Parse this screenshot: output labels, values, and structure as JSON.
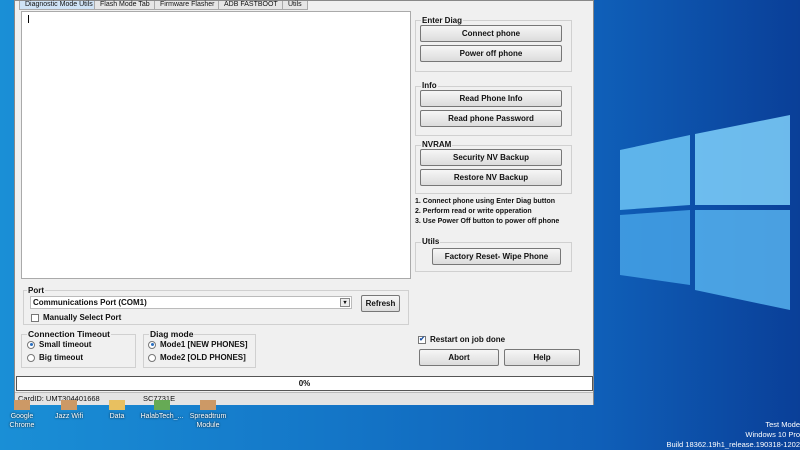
{
  "tabs": [
    "Diagnostic Mode Utils",
    "Flash Mode Tab",
    "Firmware Flasher",
    "ADB FASTBOOT",
    "Utils"
  ],
  "enter_diag": {
    "title": "Enter Diag",
    "connect": "Connect phone",
    "power_off": "Power off phone"
  },
  "info": {
    "title": "Info",
    "read_info": "Read Phone Info",
    "read_password": "Read phone Password"
  },
  "nvram": {
    "title": "NVRAM",
    "backup": "Security NV Backup",
    "restore": "Restore NV Backup"
  },
  "instructions": [
    "1. Connect phone using Enter Diag button",
    "2. Perform read or write opperation",
    "3. Use Power Off button to power off phone"
  ],
  "utils": {
    "title": "Utils",
    "factory_reset": "Factory Reset- Wipe Phone"
  },
  "port": {
    "title": "Port",
    "value": "Communications Port (COM1)",
    "refresh": "Refresh",
    "manual": "Manually Select Port"
  },
  "timeout": {
    "title": "Connection Timeout",
    "small": "Small timeout",
    "big": "Big timeout"
  },
  "diag_mode": {
    "title": "Diag mode",
    "mode1": "Mode1  [NEW PHONES]",
    "mode2": "Mode2 [OLD PHONES]"
  },
  "restart": "Restart on job done",
  "abort": "Abort",
  "help": "Help",
  "progress": {
    "value": 0,
    "label": "0%"
  },
  "status": {
    "card": "CardID: UMT304401668",
    "chip": "SC7731E"
  },
  "desktop_icons": [
    {
      "label": "Google Chrome"
    },
    {
      "label": "Jazz Wifi"
    },
    {
      "label": "Data"
    },
    {
      "label": "HalabTech_..."
    },
    {
      "label": "Spreadtrum Module"
    }
  ],
  "watermark": {
    "line1": "Test Mode",
    "line2": "Windows 10 Pro",
    "line3": "Build 18362.19h1_release.190318-1202"
  }
}
